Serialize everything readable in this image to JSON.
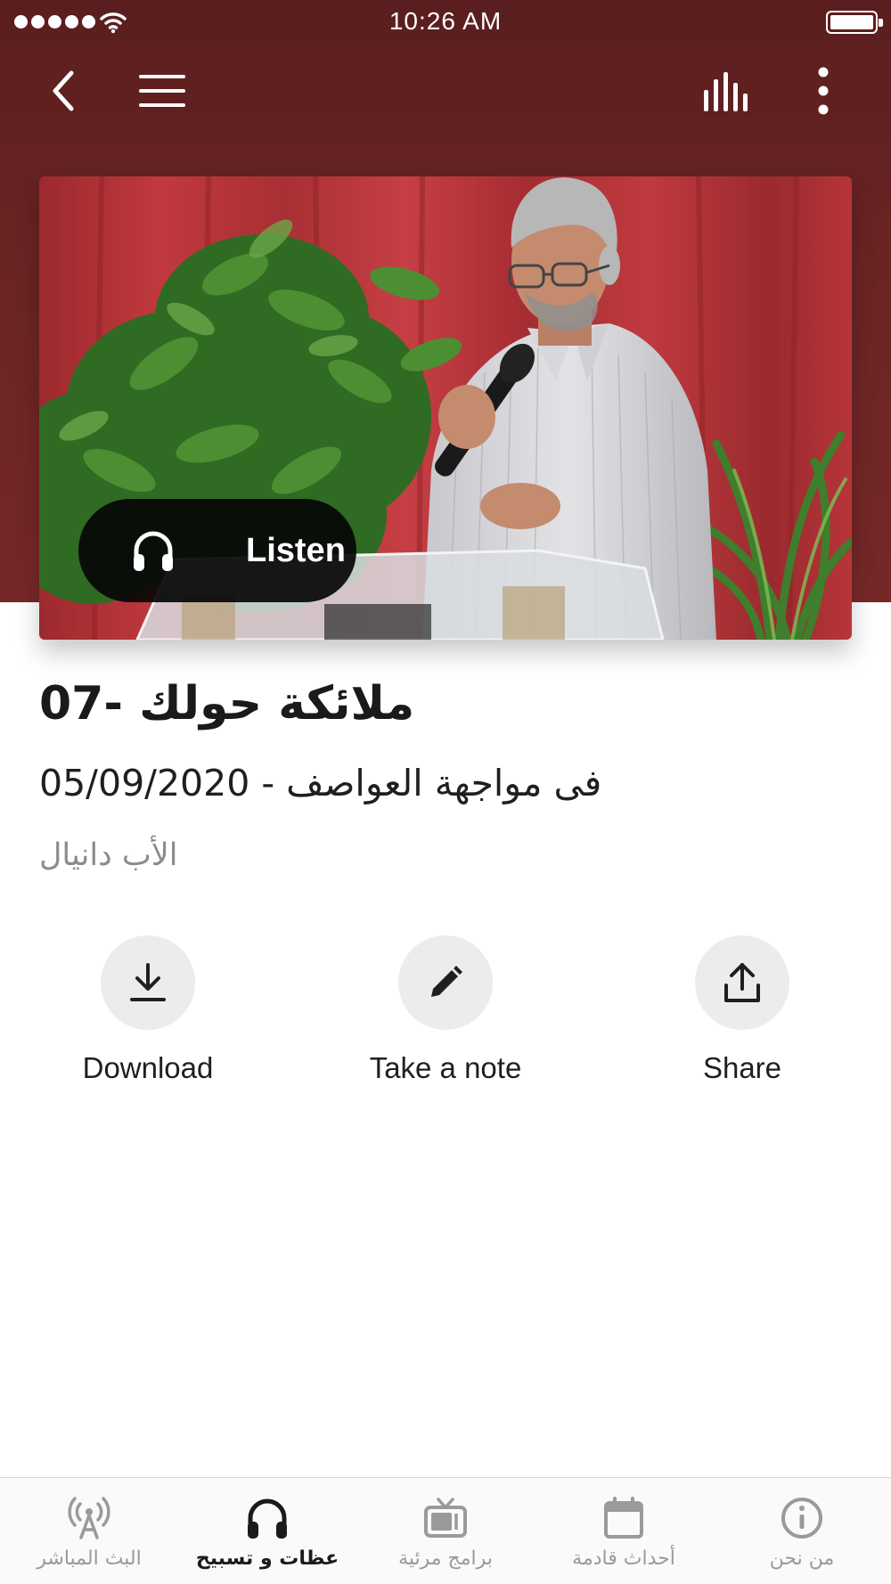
{
  "status_bar": {
    "time": "10:26 AM",
    "signal_bars": 5,
    "battery_level": 1.0
  },
  "nav": {
    "back_icon": "chevron-left-icon",
    "menu_icon": "hamburger-menu-icon",
    "equalizer_icon": "equalizer-icon",
    "more_icon": "more-vertical-icon"
  },
  "hero": {
    "listen_label": "Listen",
    "listen_icon": "headphones-icon"
  },
  "sermon": {
    "title": "07- ملائكة حولك",
    "subtitle": "فى مواجهة العواصف - 05/09/2020",
    "speaker": "الأب دانيال"
  },
  "actions": [
    {
      "label": "Download",
      "icon": "download-icon"
    },
    {
      "label": "Take a note",
      "icon": "pencil-icon"
    },
    {
      "label": "Share",
      "icon": "share-upload-icon"
    }
  ],
  "tabs": [
    {
      "label": "البث المباشر",
      "icon": "broadcast-antenna-icon",
      "active": false
    },
    {
      "label": "عظات و تسبيح",
      "icon": "headphones-icon",
      "active": true
    },
    {
      "label": "برامج مرئية",
      "icon": "tv-icon",
      "active": false
    },
    {
      "label": "أحداث قادمة",
      "icon": "calendar-icon",
      "active": false
    },
    {
      "label": "من نحن",
      "icon": "info-icon",
      "active": false
    }
  ],
  "colors": {
    "header": "#6b2424",
    "background": "#ffffff",
    "action_circle": "#ececec",
    "tab_active": "#1a1a1a",
    "tab_inactive": "#9a9a9a"
  }
}
